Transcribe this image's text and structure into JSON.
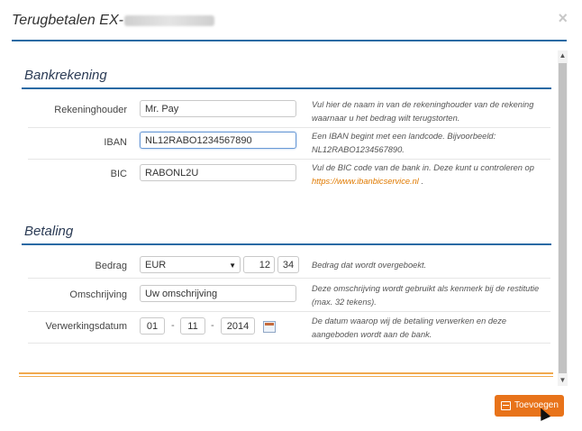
{
  "dialog": {
    "title": "Terugbetalen EX-",
    "close": "×",
    "submit_label": "Toevoegen"
  },
  "bank": {
    "title": "Bankrekening",
    "holder_label": "Rekeninghouder",
    "holder_value": "Mr. Pay",
    "holder_help": "Vul hier de naam in van de rekeninghouder van de rekening waarnaar u het bedrag wilt terugstorten.",
    "iban_label": "IBAN",
    "iban_value": "NL12RABO1234567890",
    "iban_help": "Een IBAN begint met een landcode. Bijvoorbeeld: NL12RABO1234567890.",
    "bic_label": "BIC",
    "bic_value": "RABONL2U",
    "bic_help": "Vul de BIC code van de bank in. Deze kunt u controleren op",
    "bic_link": "https://www.ibanbicservice.nl",
    "bic_help_end": " ."
  },
  "payment": {
    "title": "Betaling",
    "amount_label": "Bedrag",
    "currency": "EUR",
    "amount_whole": "12",
    "amount_cents": "34",
    "amount_help": "Bedrag dat wordt overgeboekt.",
    "description_label": "Omschrijving",
    "description_placeholder": "Uw omschrijving",
    "description_help": "Deze omschrijving wordt gebruikt als kenmerk bij de restitutie (max. 32 tekens).",
    "date_label": "Verwerkingsdatum",
    "date_day": "01",
    "date_month": "11",
    "date_year": "2014",
    "date_sep": "-",
    "date_help": "De datum waarop wij de betaling verwerken en deze aangeboden wordt aan de bank."
  },
  "scrollbar": {
    "up": "▲",
    "down": "▼"
  }
}
